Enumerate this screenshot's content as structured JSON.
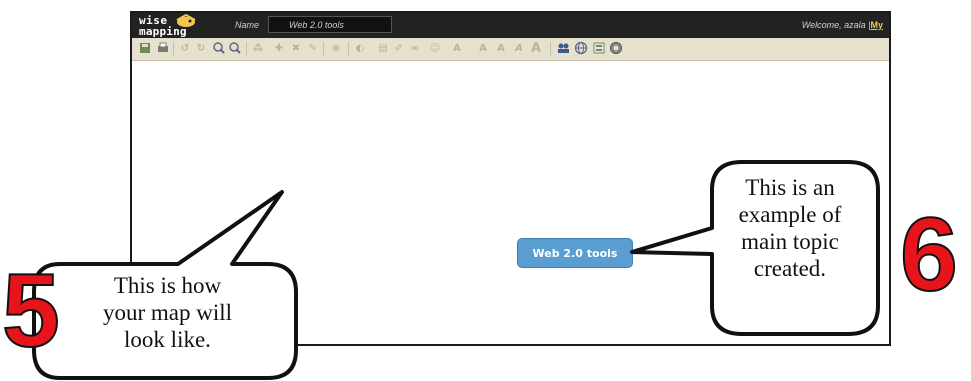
{
  "app": {
    "logo_line1": "wise",
    "logo_line2": "mapping",
    "name_label": "Name",
    "map_name": "Web 2.0 tools",
    "welcome_text": "Welcome, ",
    "user_name": "azala",
    "separator": "|",
    "my_link": "My"
  },
  "toolbar": {
    "icons": [
      "save-icon",
      "print-icon",
      "undo-icon",
      "redo-icon",
      "zoom-in-icon",
      "zoom-out-icon",
      "topic-shape-icon",
      "add-topic-icon",
      "delete-topic-icon",
      "pencil-icon",
      "relationship-icon",
      "topic-border-icon",
      "topic-color-icon",
      "note-icon",
      "link-icon",
      "icon-picker-icon",
      "font-type-icon",
      "font-size-icon",
      "font-bold-icon",
      "font-italic-icon",
      "font-color-icon",
      "share-icon",
      "publish-icon",
      "history-icon",
      "settings-icon"
    ]
  },
  "canvas": {
    "main_topic": "Web 2.0 tools"
  },
  "callouts": {
    "five": {
      "number": "5",
      "line1": "This is how",
      "line2": "your map will",
      "line3": "look like."
    },
    "six": {
      "number": "6",
      "line1": "This is an",
      "line2": "example of",
      "line3": "main topic",
      "line4": "created."
    }
  }
}
